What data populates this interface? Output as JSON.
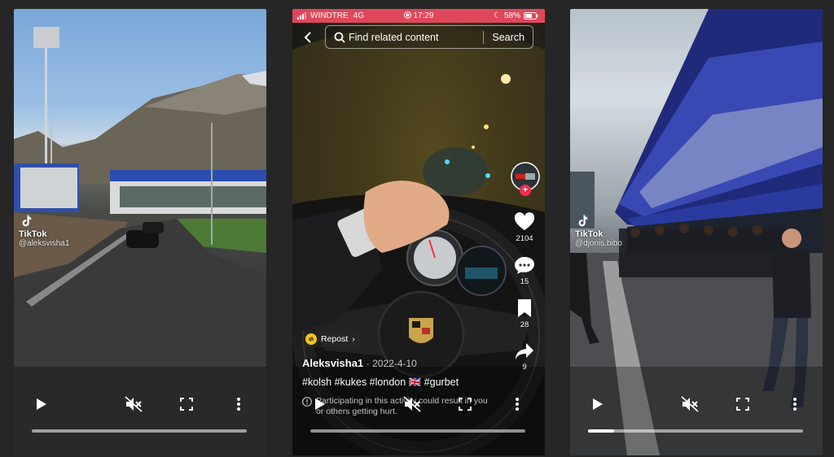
{
  "videos": [
    {
      "watermark": {
        "brand": "TikTok",
        "handle": "@aleksvisha1"
      },
      "controls": {
        "play": "play-icon",
        "mute": "mute-icon",
        "fullscreen": "fullscreen-icon",
        "more": "more-icon"
      },
      "progress": 0
    },
    {
      "status_bar": {
        "carrier": "WINDTRE",
        "network": "4G",
        "time": "17:29",
        "battery": "58%"
      },
      "search": {
        "placeholder": "Find related content",
        "button": "Search"
      },
      "actions": {
        "likes": "2104",
        "comments": "15",
        "saves": "28",
        "shares": "9"
      },
      "repost_label": "Repost",
      "author": "Aleksvisha1",
      "date": "· 2022-4-10",
      "caption": "#kolsh #kukes #london 🇬🇧 #gurbet",
      "warning": "Participating in this activity could result in you or others getting hurt.",
      "controls": {
        "play": "play-icon",
        "mute": "mute-icon",
        "fullscreen": "fullscreen-icon",
        "more": "more-icon"
      },
      "progress": 0,
      "colors": {
        "status_bar": "#e0475a",
        "follow": "#fe2c55"
      }
    },
    {
      "watermark": {
        "brand": "TikTok",
        "handle": "@djonis.bibo"
      },
      "controls": {
        "play": "play-icon",
        "mute": "mute-icon",
        "fullscreen": "fullscreen-icon",
        "more": "more-icon"
      },
      "progress": 0.12
    }
  ]
}
